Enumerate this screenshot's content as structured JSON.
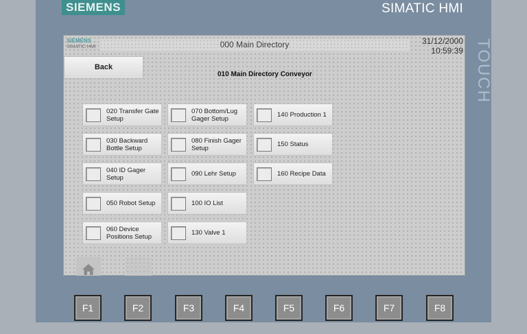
{
  "device": {
    "brand": "SIEMENS",
    "product": "SIMATIC HMI",
    "side_label": "TOUCH"
  },
  "screen": {
    "logo": "SIEMENS",
    "logo_sub": "SIMATIC HMI",
    "title": "000 Main Directory",
    "date": "31/12/2000",
    "time": "10:59:39",
    "back_label": "Back",
    "subtitle": "010 Main Directory Conveyor",
    "menu": [
      {
        "label": "020 Transfer Gate Setup"
      },
      {
        "label": "030 Backward Bottle Setup"
      },
      {
        "label": "040 ID Gager Setup"
      },
      {
        "label": "050 Robot Setup"
      },
      {
        "label": "060 Device Positions Setup"
      },
      {
        "label": "070 Bottom/Lug Gager Setup"
      },
      {
        "label": "080 Finish Gager Setup"
      },
      {
        "label": "090 Lehr Setup"
      },
      {
        "label": "100 IO List"
      },
      {
        "label": "130 Valve 1"
      },
      {
        "label": "140 Production 1"
      },
      {
        "label": "150 Status"
      },
      {
        "label": "160 Recipe Data"
      }
    ]
  },
  "function_keys": [
    "F1",
    "F2",
    "F3",
    "F4",
    "F5",
    "F6",
    "F7",
    "F8"
  ],
  "colors": {
    "brand_teal": "#3f8f8e",
    "bezel": "#7b8da0",
    "screen_bg": "#cdcdcd",
    "key_face": "#8d8d8d"
  },
  "icons": {
    "home": "home-icon"
  }
}
